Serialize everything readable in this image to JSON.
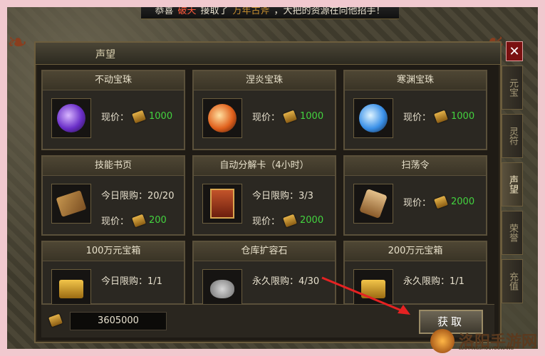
{
  "banner": {
    "prefix": "恭喜",
    "player": "破天",
    "middle": "接取了",
    "quest": "万年古斧",
    "suffix": "，大把的资源在向他招手！"
  },
  "panel": {
    "title": "声望",
    "close_symbol": "✕"
  },
  "items": [
    {
      "title": "不动宝珠",
      "price_label": "现价：",
      "price": "1000",
      "icon": "purple-orb-icon"
    },
    {
      "title": "涅炎宝珠",
      "price_label": "现价：",
      "price": "1000",
      "icon": "fire-orb-icon"
    },
    {
      "title": "寒渊宝珠",
      "price_label": "现价：",
      "price": "1000",
      "icon": "ice-orb-icon"
    },
    {
      "title": "技能书页",
      "limit": "今日限购：20/20",
      "price_label": "现价：",
      "price": "200",
      "icon": "scroll-icon"
    },
    {
      "title": "自动分解卡（4小时）",
      "limit": "今日限购：3/3",
      "price_label": "现价：",
      "price": "2000",
      "icon": "card-icon"
    },
    {
      "title": "扫荡令",
      "price_label": "现价：",
      "price": "2000",
      "icon": "token-icon"
    },
    {
      "title": "100万元宝箱",
      "limit": "今日限购：1/1",
      "icon": "treasure-chest-icon"
    },
    {
      "title": "仓库扩容石",
      "limit": "永久限购：4/30",
      "icon": "stone-icon"
    },
    {
      "title": "200万元宝箱",
      "limit": "永久限购：1/1",
      "icon": "treasure-chest-icon"
    }
  ],
  "balance": "3605000",
  "get_button": "获取",
  "side_tabs": [
    {
      "label": "元宝"
    },
    {
      "label": "灵符"
    },
    {
      "label": "声望",
      "active": true
    },
    {
      "label": "荣誉"
    },
    {
      "label": "充值"
    }
  ],
  "watermark": {
    "text": "洛阳手游网",
    "sub": "LUOYANGSHOUYOUWANG"
  },
  "colors": {
    "price_green": "#43d33f",
    "banner_red": "#ff5a3c",
    "banner_gold": "#c88f2e"
  }
}
